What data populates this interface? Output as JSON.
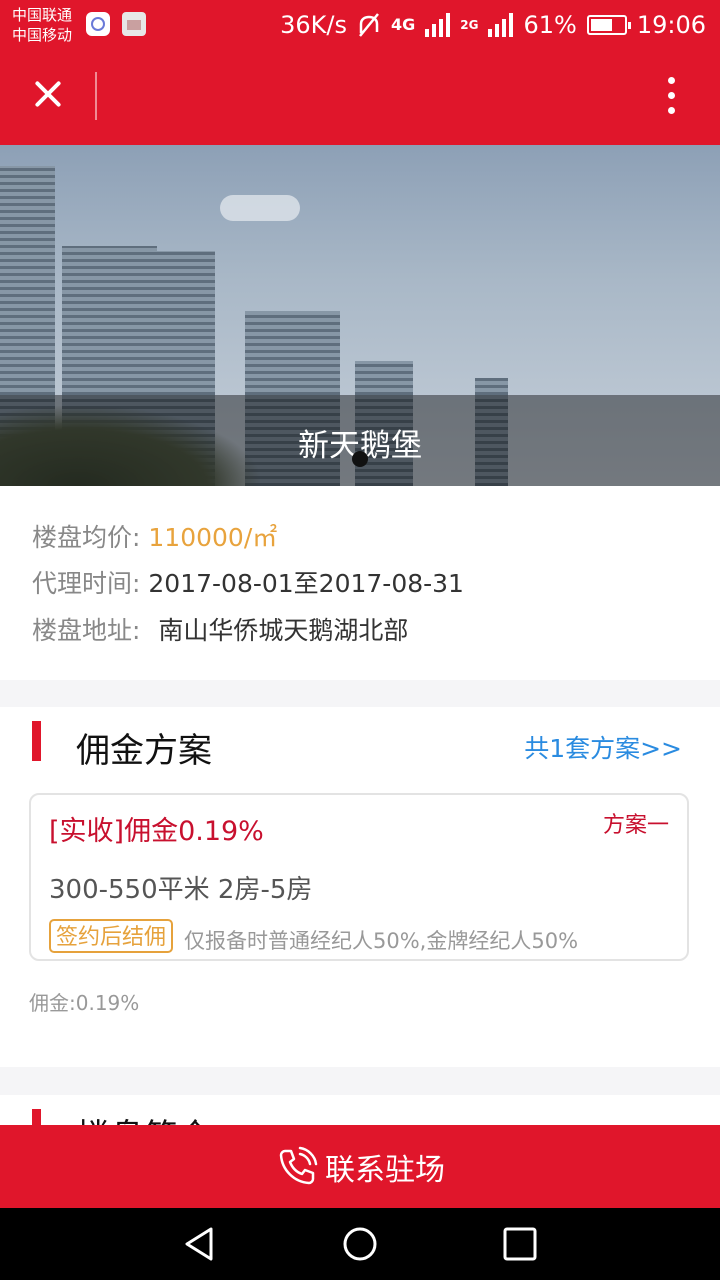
{
  "status_bar": {
    "carrier_1": "中国联通",
    "carrier_2": "中国移动",
    "net_speed": "36K/s",
    "net_4g": "4G",
    "net_2g": "2G",
    "battery": "61%",
    "time": "19:06"
  },
  "app_bar": {
    "close_icon": "close-icon",
    "more_icon": "more-vertical-icon"
  },
  "hero": {
    "title": "新天鹅堡"
  },
  "info": {
    "price_label": "楼盘均价:",
    "price_value": "110000/㎡",
    "agent_time_label": "代理时间:",
    "agent_time_value": "2017-08-01至2017-08-31",
    "address_label": "楼盘地址:",
    "address_value": "南山华侨城天鹅湖北部"
  },
  "commission": {
    "title": "佣金方案",
    "link": "共1套方案>>",
    "plan": {
      "commission": "[实收]佣金0.19%",
      "name": "方案一",
      "spec": "300-550平米 2房-5房",
      "tag": "签约后结佣",
      "note": "仅报备时普通经纪人50%,金牌经纪人50%"
    },
    "footer": "佣金:0.19%"
  },
  "next_section": {
    "title": "楼盘简介"
  },
  "contact_button": {
    "label": "联系驻场",
    "icon": "phone-icon"
  },
  "colors": {
    "brand_red": "#e0162b",
    "price_orange": "#e8a33d",
    "link_blue": "#2a8be0",
    "tag_orange": "#e6a23c"
  }
}
